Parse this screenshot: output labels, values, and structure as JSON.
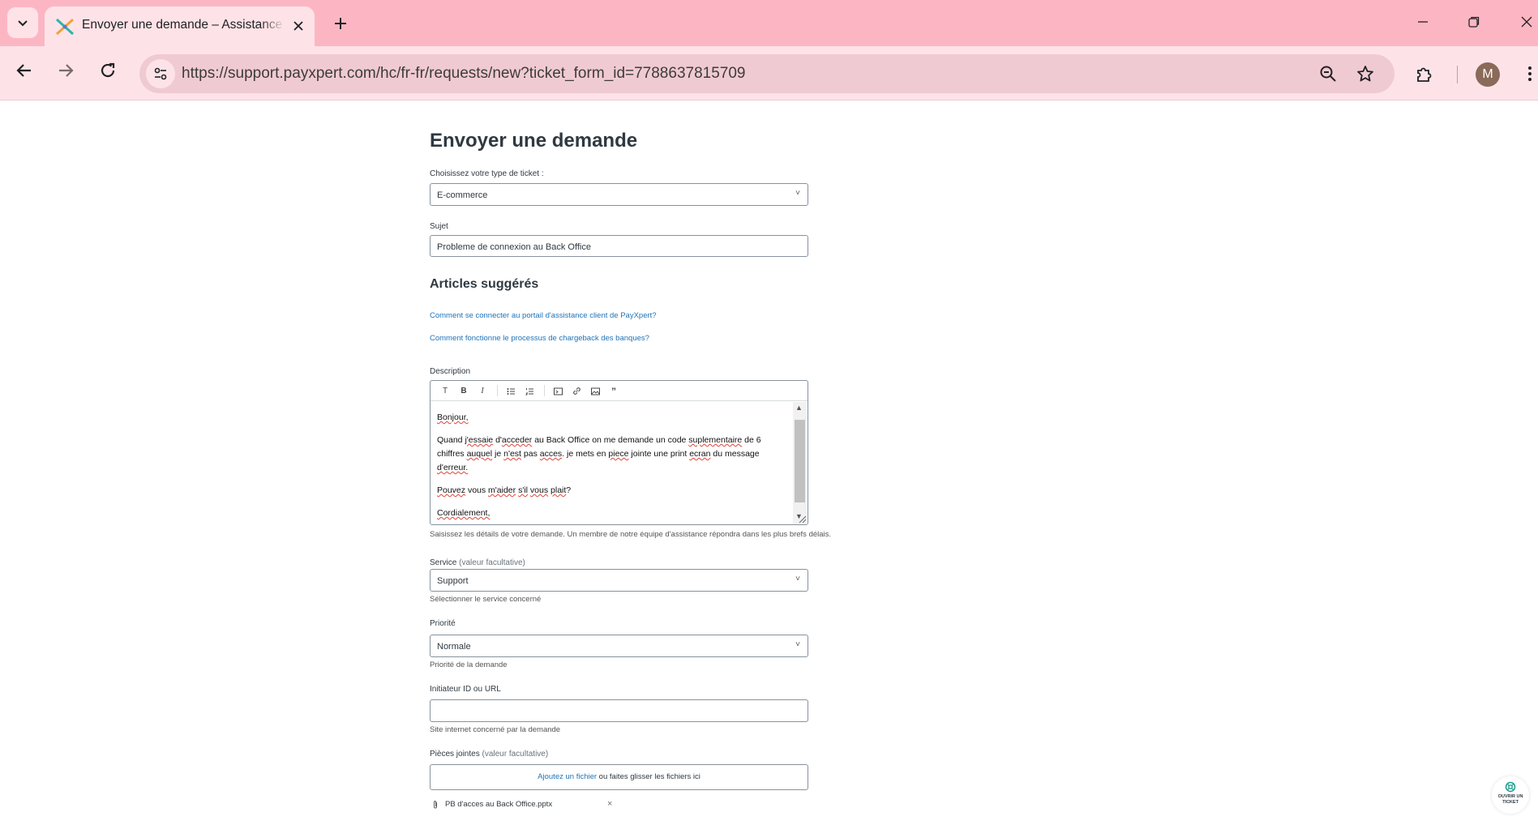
{
  "browser": {
    "tab_title": "Envoyer une demande – Assistance PayXpert",
    "url": "https://support.payxpert.com/hc/fr-fr/requests/new?ticket_form_id=7788637815709",
    "profile_initial": "M"
  },
  "form": {
    "title": "Envoyer une demande",
    "ticket_type": {
      "label": "Choisissez votre type de ticket :",
      "value": "E-commerce"
    },
    "subject": {
      "label": "Sujet",
      "value": "Probleme de connexion au Back Office"
    },
    "suggested": {
      "heading": "Articles suggérés",
      "articles": [
        "Comment se connecter au portail d'assistance client de PayXpert?",
        "Comment fonctionne le processus de chargeback des banques?"
      ]
    },
    "description": {
      "label": "Description",
      "toolbar": [
        "text-format",
        "bold",
        "italic",
        "bullet-list",
        "numbered-list",
        "code-block",
        "link",
        "image",
        "quote"
      ],
      "greeting": "Bonjour,",
      "line1a": "Quand ",
      "line1b": "j'essaie",
      "line1c": " d'",
      "line1d": "acceder",
      "line1e": " au Back Office on me demande un code ",
      "line1f": "suplementaire",
      "line1g": " de 6",
      "line2a": "chiffres ",
      "line2b": "auquel",
      "line2c": " je ",
      "line2d": "n'est",
      "line2e": " pas ",
      "line2f": "acces",
      "line2g": ". je mets en ",
      "line2h": "piece",
      "line2i": " jointe une print ",
      "line2j": "ecran",
      "line2k": " du message",
      "line3": "d'erreur.",
      "question_a": "Pouvez",
      "question_b": " vous ",
      "question_c": "m'aider",
      "question_d": " ",
      "question_e": "s'il",
      "question_f": " ",
      "question_g": "vous",
      "question_h": " ",
      "question_i": "plait",
      "question_j": "?",
      "closing": "Cordialement,",
      "hint": "Saisissez les détails de votre demande. Un membre de notre équipe d'assistance répondra dans les plus brefs délais."
    },
    "service": {
      "label": "Service",
      "optional": "(valeur facultative)",
      "value": "Support",
      "hint": "Sélectionner le service concerné"
    },
    "priority": {
      "label": "Priorité",
      "value": "Normale",
      "hint": "Priorité de la demande"
    },
    "initiator": {
      "label": "Initiateur ID ou URL",
      "value": "",
      "hint": "Site internet concerné par la demande"
    },
    "attachments": {
      "label": "Pièces jointes",
      "optional": "(valeur facultative)",
      "add_link": "Ajoutez un fichier",
      "drop_text": " ou faites glisser les fichiers ici",
      "file_name": "PB d'acces au Back Office.pptx",
      "remove": "×"
    }
  },
  "widget": {
    "line1": "OUVRIR UN",
    "line2": "TICKET"
  },
  "colors": {
    "chrome": "#fcb6c3",
    "chrome_light": "#fde3e8",
    "link": "#1f73b7",
    "text": "#2f3941"
  }
}
